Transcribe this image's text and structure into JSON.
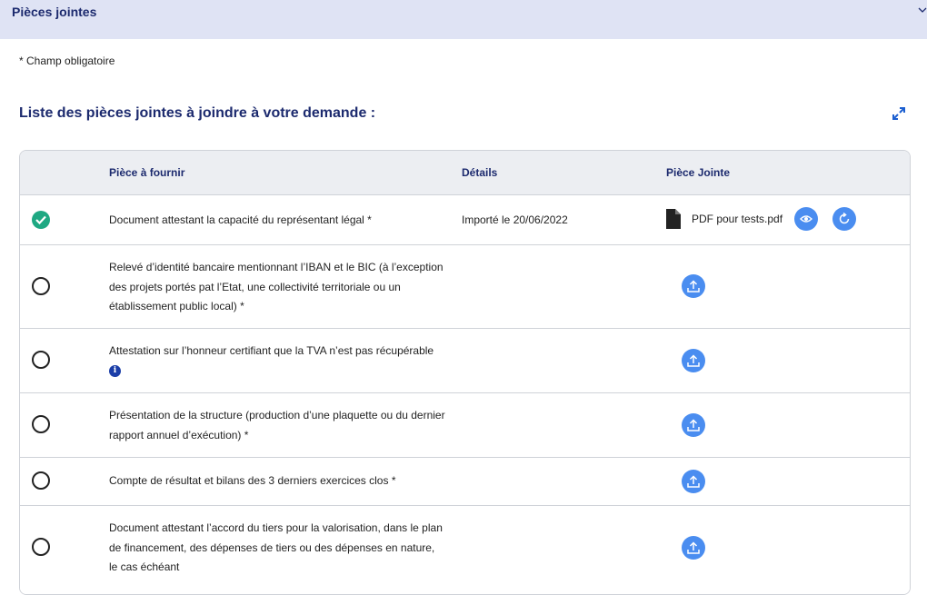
{
  "section": {
    "title": "Pièces jointes"
  },
  "required_note": "* Champ obligatoire",
  "list_title": "Liste des pièces jointes à joindre à votre demande :",
  "table": {
    "headers": {
      "piece": "Pièce à fournir",
      "details": "Détails",
      "attachment": "Pièce Jointe"
    },
    "rows": [
      {
        "label": "Document attestant la capacité du représentant légal *",
        "status": "complete",
        "details": "Importé le 20/06/2022",
        "file_name": "PDF pour tests.pdf"
      },
      {
        "label": "Relevé d’identité bancaire mentionnant l’IBAN et le BIC (à l’exception des projets portés pat l’Etat, une collectivité territoriale ou un établissement public local) *",
        "status": "empty"
      },
      {
        "label": "Attestation sur l’honneur certifiant que la TVA n’est pas récupérable",
        "status": "empty",
        "info_icon": "i"
      },
      {
        "label": "Présentation de la structure (production d’une plaquette ou du dernier rapport annuel d’exécution) *",
        "status": "empty"
      },
      {
        "label": "Compte de résultat et bilans des 3 derniers exercices clos *",
        "status": "empty"
      },
      {
        "label": "Document attestant l’accord du tiers pour la valorisation, dans le plan de financement, des dépenses de tiers ou des dépenses en nature, le cas échéant",
        "status": "empty"
      }
    ]
  },
  "colors": {
    "accent": "#4a8df0",
    "success": "#1ea882",
    "header_bg": "#dfe3f4",
    "title": "#1c2a6e"
  },
  "icons": {
    "collapse": "chevron-down-icon",
    "expand": "expand-icon",
    "complete": "check-circle-icon",
    "pending": "empty-circle-icon",
    "file": "file-icon",
    "view": "eye-icon",
    "replace": "refresh-icon",
    "upload": "upload-icon",
    "info": "info-icon"
  }
}
